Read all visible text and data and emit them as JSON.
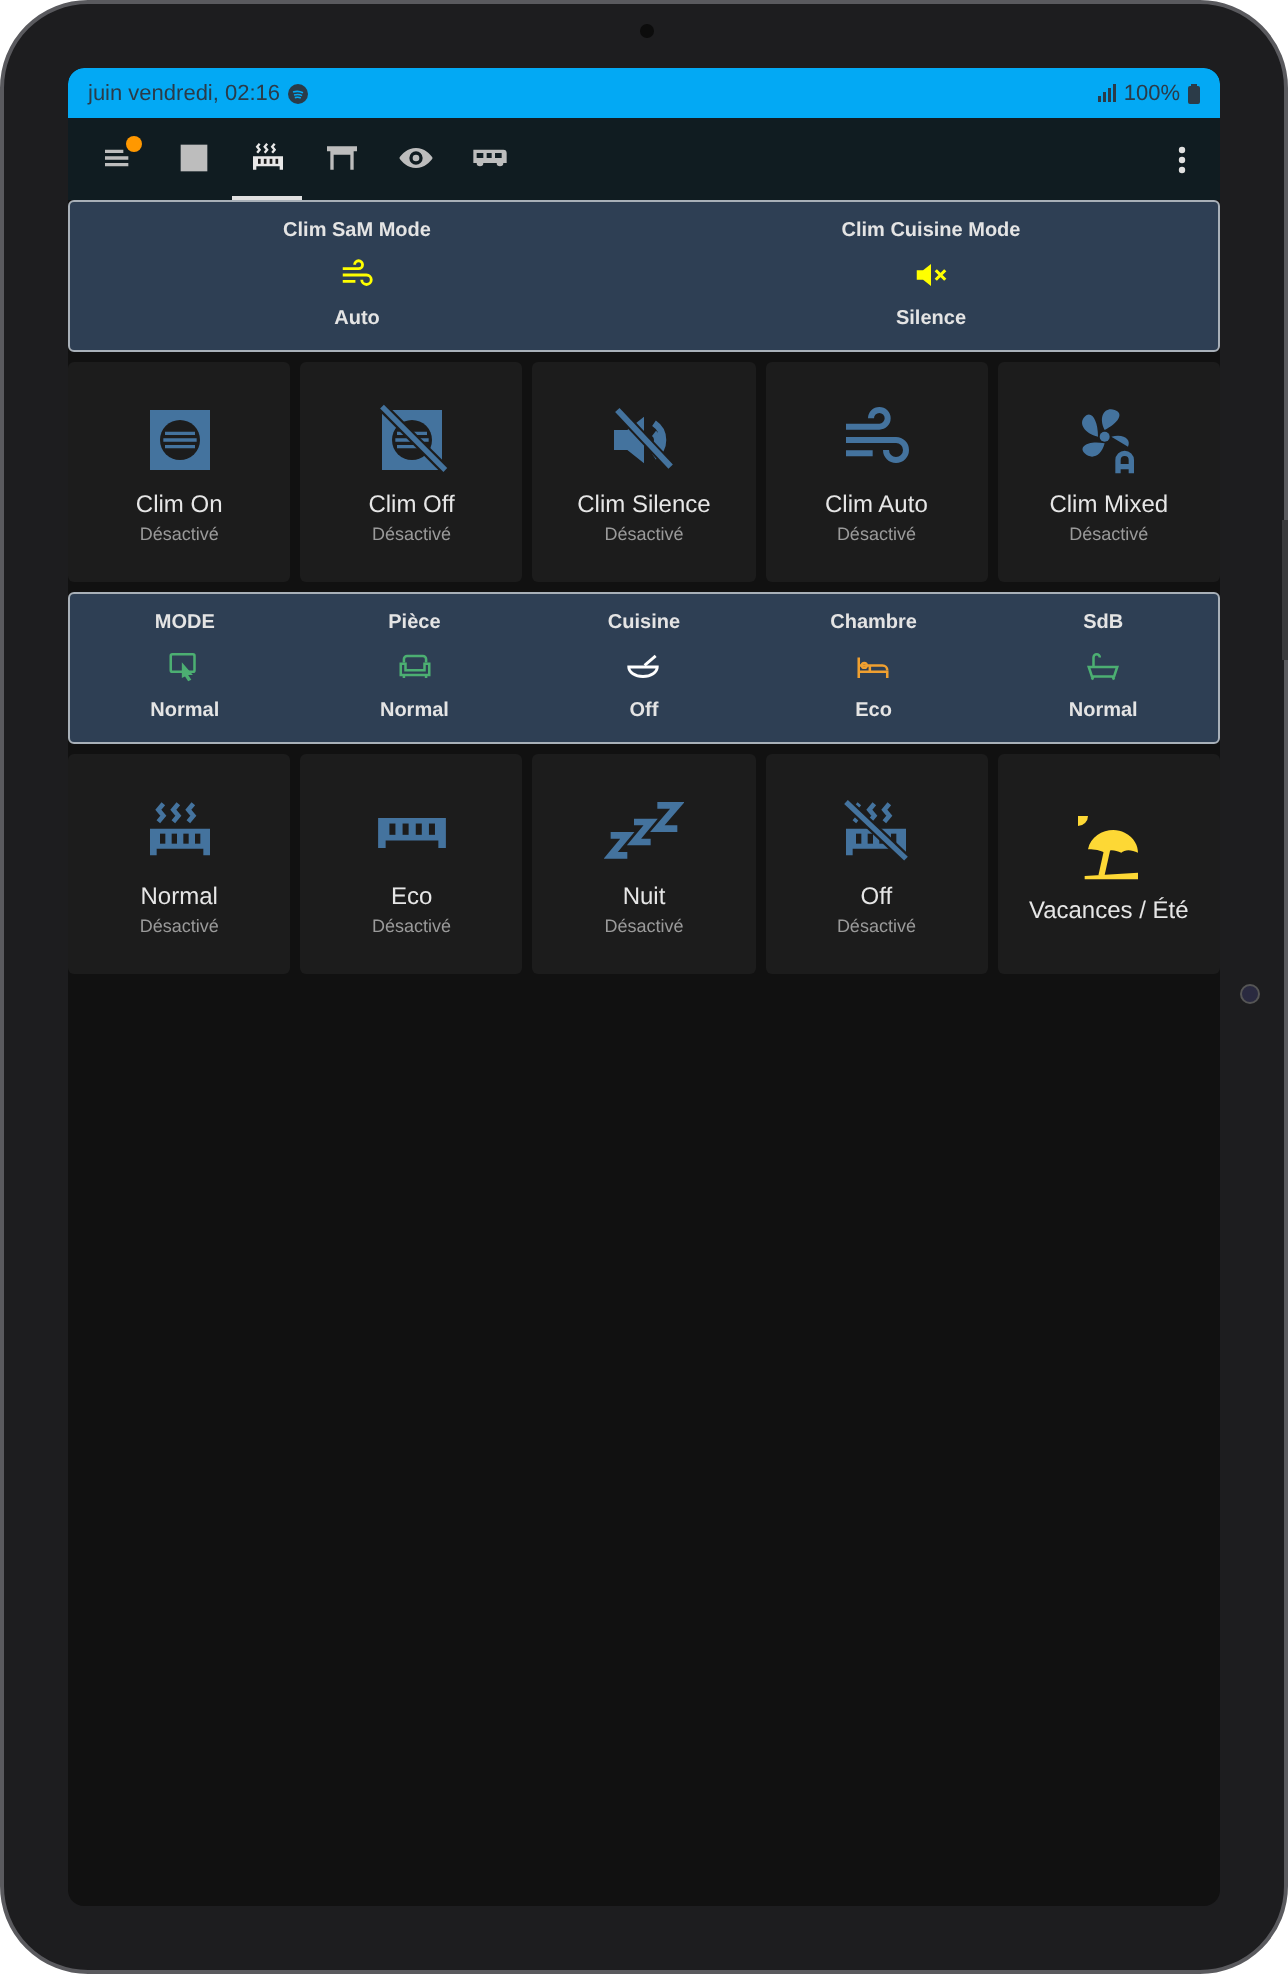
{
  "status_bar": {
    "date_time": "juin vendredi, 02:16",
    "battery": "100%"
  },
  "tabs": [
    {
      "kind": "menu",
      "selected": false,
      "notification": true
    },
    {
      "kind": "square",
      "selected": false,
      "notification": false
    },
    {
      "kind": "radiator",
      "selected": true,
      "notification": false
    },
    {
      "kind": "table",
      "selected": false,
      "notification": false
    },
    {
      "kind": "eye",
      "selected": false,
      "notification": false
    },
    {
      "kind": "rv",
      "selected": false,
      "notification": false
    }
  ],
  "clim_modes": [
    {
      "name": "Clim SaM Mode",
      "kind": "wind",
      "color": "#ffff00",
      "state": "Auto"
    },
    {
      "name": "Clim Cuisine Mode",
      "kind": "mute",
      "color": "#ffff00",
      "state": "Silence"
    }
  ],
  "clim_tiles": [
    {
      "name": "Clim On",
      "state": "Désactivé",
      "kind": "vent",
      "color": "#44739e"
    },
    {
      "name": "Clim Off",
      "state": "Désactivé",
      "kind": "ventoff",
      "color": "#44739e"
    },
    {
      "name": "Clim Silence",
      "state": "Désactivé",
      "kind": "volumeoff",
      "color": "#44739e"
    },
    {
      "name": "Clim Auto",
      "state": "Désactivé",
      "kind": "wind",
      "color": "#44739e"
    },
    {
      "name": "Clim Mixed",
      "state": "Désactivé",
      "kind": "fan",
      "color": "#44739e"
    }
  ],
  "heating_modes": [
    {
      "name": "MODE",
      "kind": "touch",
      "color": "#4caf72",
      "state": "Normal"
    },
    {
      "name": "Pièce",
      "kind": "sofa",
      "color": "#4caf72",
      "state": "Normal"
    },
    {
      "name": "Cuisine",
      "kind": "bowl",
      "color": "#ffffff",
      "state": "Off"
    },
    {
      "name": "Chambre",
      "kind": "bed",
      "color": "#f0a030",
      "state": "Eco"
    },
    {
      "name": "SdB",
      "kind": "bath",
      "color": "#4caf72",
      "state": "Normal"
    }
  ],
  "heating_tiles": [
    {
      "name": "Normal",
      "state": "Désactivé",
      "kind": "radiator",
      "color": "#44739e"
    },
    {
      "name": "Eco",
      "state": "Désactivé",
      "kind": "radiatorcold",
      "color": "#44739e"
    },
    {
      "name": "Nuit",
      "state": "Désactivé",
      "kind": "sleep",
      "color": "#44739e"
    },
    {
      "name": "Off",
      "state": "Désactivé",
      "kind": "radiatoroff",
      "color": "#44739e"
    },
    {
      "name": "Vacances / Été",
      "kind": "beach",
      "color": "#fdd835"
    }
  ]
}
